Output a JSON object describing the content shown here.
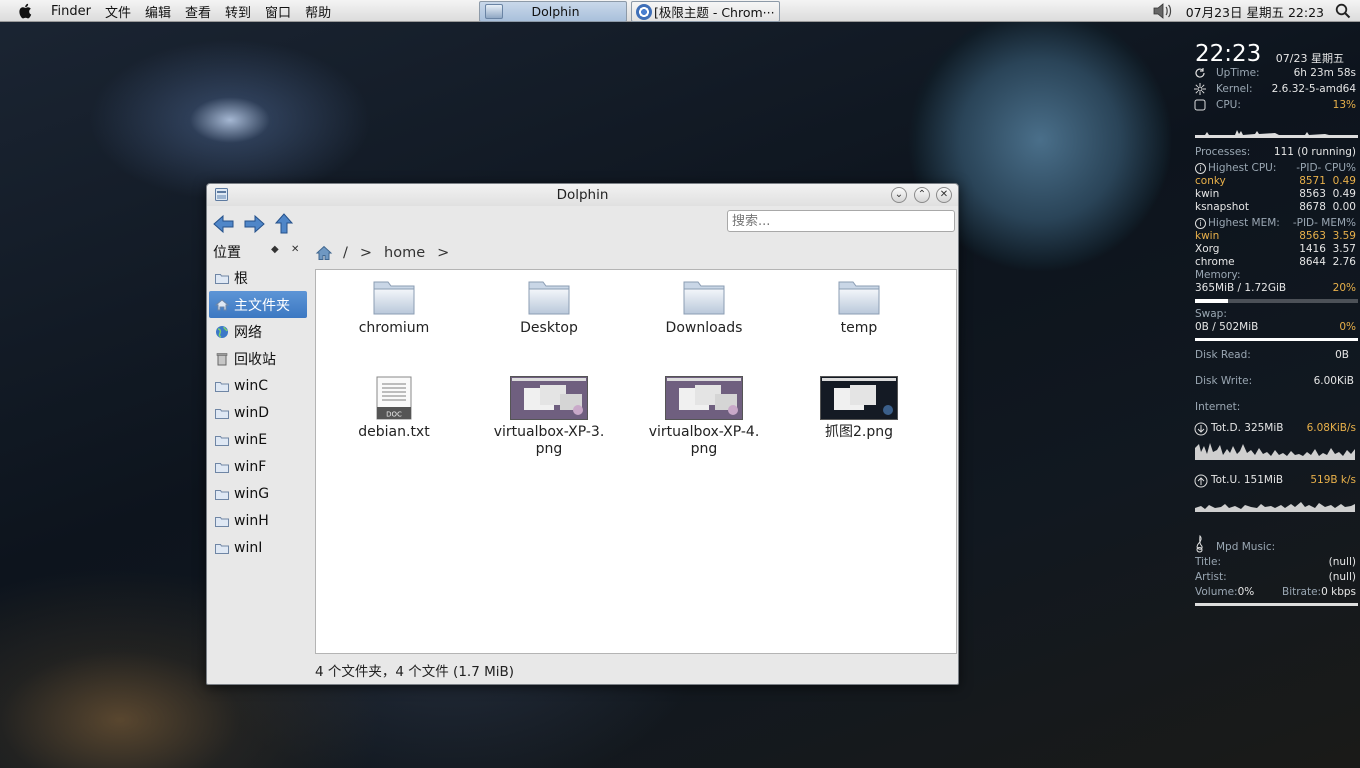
{
  "menubar": {
    "items": [
      "Finder",
      "文件",
      "编辑",
      "查看",
      "转到",
      "窗口",
      "帮助"
    ],
    "tasks": [
      {
        "label": "Dolphin",
        "active": true
      },
      {
        "label": "[极限主题 - Chrom···",
        "active": false
      }
    ],
    "clock": "07月23日 星期五 22:23"
  },
  "conky": {
    "time": "22:23",
    "date": "07/23 星期五",
    "uptime_label": "UpTime:",
    "uptime": "6h 23m 58s",
    "kernel_label": "Kernel:",
    "kernel": "2.6.32-5-amd64",
    "cpu_label": "CPU:",
    "cpu": "13%",
    "processes_label": "Processes:",
    "processes": "111  (0 running)",
    "highest_cpu_label": "Highest CPU:",
    "cpu_cols": "-PID-  CPU%",
    "cpu_procs": [
      {
        "name": "conky",
        "pid": "8571",
        "val": "0.49"
      },
      {
        "name": "kwin",
        "pid": "8563",
        "val": "0.49"
      },
      {
        "name": "ksnapshot",
        "pid": "8678",
        "val": "0.00"
      }
    ],
    "highest_mem_label": "Highest MEM:",
    "mem_cols": "-PID-  MEM%",
    "mem_procs": [
      {
        "name": "kwin",
        "pid": "8563",
        "val": "3.59"
      },
      {
        "name": "Xorg",
        "pid": "1416",
        "val": "3.57"
      },
      {
        "name": "chrome",
        "pid": "8644",
        "val": "2.76"
      }
    ],
    "memory_label": "Memory:",
    "memory": "365MiB / 1.72GiB",
    "memory_pct": "20%",
    "memory_fraction": 0.2,
    "swap_label": "Swap:",
    "swap": "0B  / 502MiB",
    "swap_pct": "0%",
    "disk_read_label": "Disk Read:",
    "disk_read": "0B",
    "disk_write_label": "Disk Write:",
    "disk_write": "6.00KiB",
    "internet_label": "Internet:",
    "down_total": "Tot.D. 325MiB",
    "down_rate": "6.08KiB/s",
    "up_total": "Tot.U. 151MiB",
    "up_rate": "519B  k/s",
    "mpd_label": "Mpd Music:",
    "title_label": "Title:",
    "title": "(null)",
    "artist_label": "Artist:",
    "artist": "(null)",
    "volume_label": "Volume:",
    "volume": "0%",
    "bitrate_label": "Bitrate:",
    "bitrate": "0 kbps"
  },
  "window": {
    "title": "Dolphin",
    "search_placeholder": "搜索...",
    "places_title": "位置",
    "places": [
      {
        "label": "根",
        "icon": "folder-icon",
        "selected": false
      },
      {
        "label": "主文件夹",
        "icon": "home-icon",
        "selected": true
      },
      {
        "label": "网络",
        "icon": "globe-icon",
        "selected": false
      },
      {
        "label": "回收站",
        "icon": "trash-icon",
        "selected": false
      },
      {
        "label": "winC",
        "icon": "folder-icon",
        "selected": false
      },
      {
        "label": "winD",
        "icon": "folder-icon",
        "selected": false
      },
      {
        "label": "winE",
        "icon": "folder-icon",
        "selected": false
      },
      {
        "label": "winF",
        "icon": "folder-icon",
        "selected": false
      },
      {
        "label": "winG",
        "icon": "folder-icon",
        "selected": false
      },
      {
        "label": "winH",
        "icon": "folder-icon",
        "selected": false
      },
      {
        "label": "winI",
        "icon": "folder-icon",
        "selected": false
      }
    ],
    "breadcrumb": [
      "/",
      "home"
    ],
    "items": [
      {
        "label": "chromium",
        "type": "folder"
      },
      {
        "label": "Desktop",
        "type": "folder"
      },
      {
        "label": "Downloads",
        "type": "folder"
      },
      {
        "label": "temp",
        "type": "folder"
      },
      {
        "label": "debian.txt",
        "type": "text"
      },
      {
        "label": "virtualbox-XP-3.\npng",
        "type": "image"
      },
      {
        "label": "virtualbox-XP-4.\npng",
        "type": "image"
      },
      {
        "label": "抓图2.png",
        "type": "image-dark"
      }
    ],
    "doc_badge": "DOC",
    "status": "4 个文件夹，4 个文件 (1.7 MiB)"
  }
}
